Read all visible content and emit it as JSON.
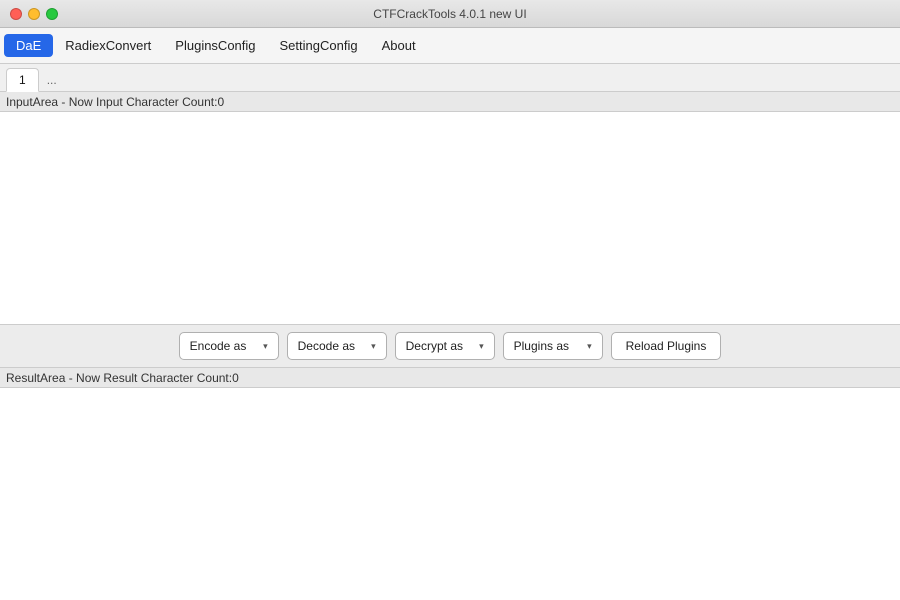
{
  "titleBar": {
    "title": "CTFCrackTools 4.0.1 new UI"
  },
  "menuBar": {
    "items": [
      {
        "id": "dae",
        "label": "DaE",
        "active": true
      },
      {
        "id": "radiex-convert",
        "label": "RadiexConvert",
        "active": false
      },
      {
        "id": "plugins-config",
        "label": "PluginsConfig",
        "active": false
      },
      {
        "id": "setting-config",
        "label": "SettingConfig",
        "active": false
      },
      {
        "id": "about",
        "label": "About",
        "active": false
      }
    ]
  },
  "tabBar": {
    "tabs": [
      {
        "id": "tab-1",
        "label": "1",
        "active": true
      },
      {
        "id": "tab-ellipsis",
        "label": "...",
        "active": false
      }
    ]
  },
  "inputArea": {
    "label": "InputArea - Now Input Character Count:0",
    "placeholder": ""
  },
  "buttonBar": {
    "encode": {
      "label": "Encode as",
      "arrow": "▾"
    },
    "decode": {
      "label": "Decode as",
      "arrow": "▾"
    },
    "decrypt": {
      "label": "Decrypt as",
      "arrow": "▾"
    },
    "plugins": {
      "label": "Plugins as",
      "arrow": "▾"
    },
    "reload": {
      "label": "Reload Plugins"
    }
  },
  "resultArea": {
    "label": "ResultArea - Now Result Character Count:0",
    "placeholder": ""
  },
  "trafficLights": {
    "close": "close",
    "minimize": "minimize",
    "maximize": "maximize"
  }
}
